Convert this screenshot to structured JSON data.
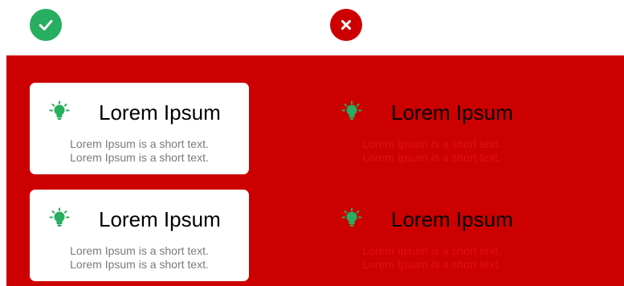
{
  "colors": {
    "panel_background": "#cc0000",
    "good_badge": "#27ae60",
    "bad_badge": "#cc0000",
    "bulb": "#27ae60",
    "title_text": "#000000",
    "body_text_good": "#7a7a7a",
    "body_text_bad": "#e01010"
  },
  "badges": {
    "good_icon": "check-icon",
    "bad_icon": "x-icon"
  },
  "good_examples": [
    {
      "icon": "lightbulb-icon",
      "title": "Lorem Ipsum",
      "line1": "Lorem Ipsum is a short text.",
      "line2": "Lorem Ipsum is a short text."
    },
    {
      "icon": "lightbulb-icon",
      "title": "Lorem Ipsum",
      "line1": "Lorem Ipsum is a short text.",
      "line2": "Lorem Ipsum is a short text."
    }
  ],
  "bad_examples": [
    {
      "icon": "lightbulb-icon",
      "title": "Lorem Ipsum",
      "line1": "Lorem Ipsum is a short text.",
      "line2": "Lorem Ipsum is a short text."
    },
    {
      "icon": "lightbulb-icon",
      "title": "Lorem Ipsum",
      "line1": "Lorem Ipsum is a short text.",
      "line2": "Lorem Ipsum is a short text."
    }
  ]
}
